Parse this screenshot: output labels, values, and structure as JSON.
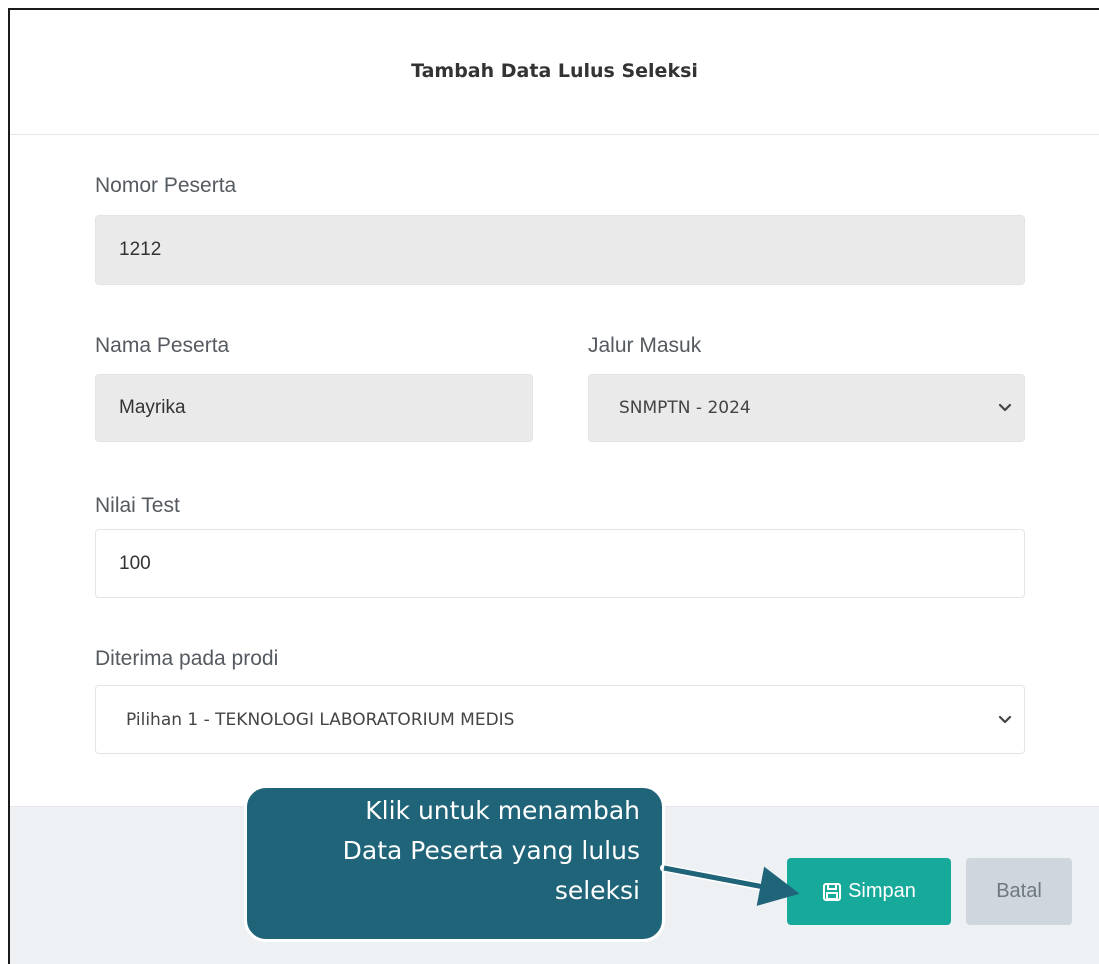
{
  "modal": {
    "title": "Tambah Data Lulus Seleksi"
  },
  "form": {
    "nomor_peserta": {
      "label": "Nomor Peserta",
      "value": "1212"
    },
    "nama_peserta": {
      "label": "Nama Peserta",
      "value": "Mayrika"
    },
    "jalur_masuk": {
      "label": "Jalur Masuk",
      "value": "SNMPTN - 2024"
    },
    "nilai_test": {
      "label": "Nilai Test",
      "value": "100"
    },
    "diterima_prodi": {
      "label": "Diterima pada prodi",
      "value": "Pilihan 1 - TEKNOLOGI LABORATORIUM MEDIS"
    }
  },
  "footer": {
    "save_label": "Simpan",
    "save_icon": "floppy-disk-icon",
    "cancel_label": "Batal"
  },
  "annotation": {
    "lines": [
      "Klik untuk menambah",
      "Data Peserta yang lulus",
      "seleksi"
    ],
    "color": "#1f6479"
  },
  "colors": {
    "primary": "#17a99a",
    "secondary": "#cfd6dd",
    "readonly_bg": "#eaeaea"
  }
}
